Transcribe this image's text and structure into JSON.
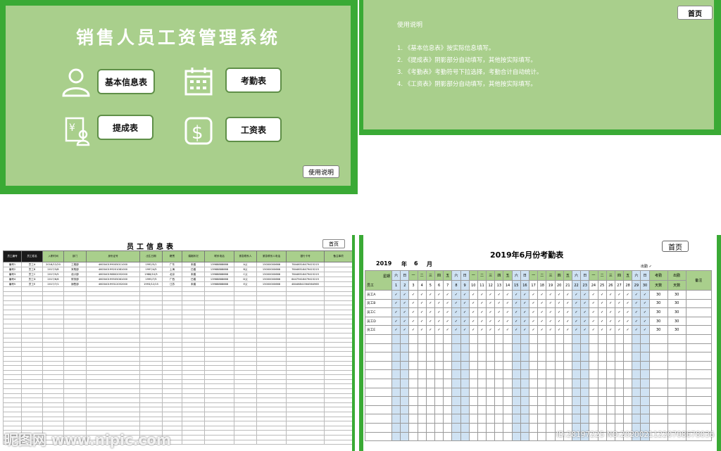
{
  "menu": {
    "title": "销售人员工资管理系统",
    "buttons": [
      {
        "label": "基本信息表",
        "icon": "user-icon"
      },
      {
        "label": "考勤表",
        "icon": "calendar-icon"
      },
      {
        "label": "提成表",
        "icon": "commission-icon"
      },
      {
        "label": "工资表",
        "icon": "dollar-icon"
      }
    ],
    "help_label": "使用说明"
  },
  "instructions": {
    "home_label": "首页",
    "title": "使用说明",
    "lines": [
      "1. 《基本信息表》按实际信息填写。",
      "2. 《提成表》阴影部分自动填写，其他按实际填写。",
      "3. 《考勤表》考勤符号下拉选择，考勤合计自动统计。",
      "4. 《工资表》阴影部分自动填写，其他按实际填写。"
    ]
  },
  "employee_sheet": {
    "title": "员工信息表",
    "home_label": "首页",
    "headers": [
      "员工编号",
      "员工姓名",
      "入职时间",
      "部门",
      "身份证号",
      "出生日期",
      "籍贯",
      "婚姻状况",
      "联系电话",
      "紧急联系人",
      "紧急联系人电话",
      "银行卡号",
      "备注事项"
    ],
    "rows": [
      [
        "编号1",
        "员工A",
        "2016/12/20",
        "工程部",
        "460340199005011000",
        "1992/5/1",
        "广东",
        "未婚",
        "13988888888",
        "A父",
        "15000000666",
        "78446516479415215",
        ""
      ],
      [
        "编号2",
        "员工B",
        "2017/3/8",
        "采购部",
        "460340199201081000",
        "1997/4/5",
        "上海",
        "已婚",
        "13988888888",
        "B父",
        "15000000666",
        "78446516479415215",
        ""
      ],
      [
        "编号3",
        "员工C",
        "2017/5/5",
        "设计部",
        "460340198802052000",
        "1988/10/5",
        "北京",
        "未婚",
        "13988888888",
        "C父",
        "15000000666",
        "78446516479415215",
        ""
      ],
      [
        "编号4",
        "员工D",
        "2017/6/6",
        "财务部",
        "460340199505061000",
        "1995/7/5",
        "广西",
        "已婚",
        "13988888888",
        "D父",
        "15000000666",
        "64479416479415215",
        ""
      ],
      [
        "编号5",
        "员工E",
        "2017/7/1",
        "销售部",
        "460340199312052000",
        "1993/12/15",
        "江苏",
        "未婚",
        "13988888888",
        "E父",
        "15000000666",
        "48446841564564965",
        ""
      ]
    ]
  },
  "attendance": {
    "title": "2019年6月份考勤表",
    "home_label": "首页",
    "year": "2019",
    "year_unit": "年",
    "month": "6",
    "month_unit": "月",
    "legend": "出勤 ✓",
    "corner_top": "星期",
    "corner_bottom": "员工",
    "weekdays": [
      "六",
      "日",
      "一",
      "二",
      "三",
      "四",
      "五",
      "六",
      "日",
      "一",
      "二",
      "三",
      "四",
      "五",
      "六",
      "日",
      "一",
      "二",
      "三",
      "四",
      "五",
      "六",
      "日",
      "一",
      "二",
      "三",
      "四",
      "五",
      "六",
      "日"
    ],
    "days": [
      "1",
      "2",
      "3",
      "4",
      "5",
      "6",
      "7",
      "8",
      "9",
      "10",
      "11",
      "12",
      "13",
      "14",
      "15",
      "16",
      "17",
      "18",
      "19",
      "20",
      "21",
      "22",
      "23",
      "24",
      "25",
      "26",
      "27",
      "28",
      "29",
      "30"
    ],
    "summary_headers": [
      "考勤",
      "出勤",
      "备注"
    ],
    "summary_sub": [
      "天数",
      "天数"
    ],
    "check": "✓",
    "employees": [
      {
        "name": "员工A",
        "total": "30",
        "present": "30"
      },
      {
        "name": "员工B",
        "total": "30",
        "present": "30"
      },
      {
        "name": "员工C",
        "total": "30",
        "present": "30"
      },
      {
        "name": "员工D",
        "total": "30",
        "present": "30"
      },
      {
        "name": "员工E",
        "total": "30",
        "present": "30"
      }
    ]
  },
  "watermark": {
    "brand": "昵图网 www.nipic.com",
    "id_text": "ID:28197225 NO:20200211220708678036"
  }
}
